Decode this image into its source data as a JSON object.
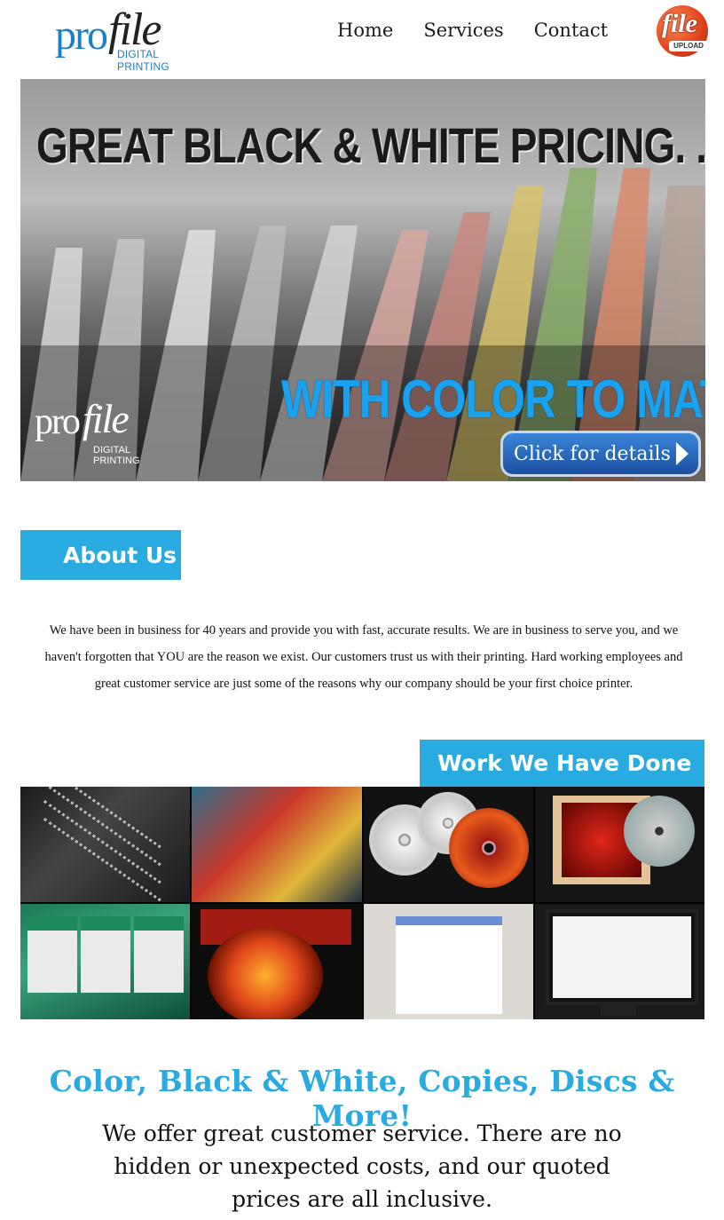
{
  "header": {
    "logo": {
      "pro": "pro",
      "file": "file",
      "sub": "DIGITAL PRINTING"
    },
    "nav": [
      "Home",
      "Services",
      "Contact"
    ],
    "upload_badge": {
      "big": "file",
      "small": "UPLOAD"
    }
  },
  "hero": {
    "headline": "GREAT BLACK & WHITE PRICING. . .",
    "subheadline": "WITH COLOR TO MATCH",
    "logo": {
      "pro": "pro",
      "file": "file",
      "sub": "DIGITAL PRINTING"
    },
    "button_label": "Click for details"
  },
  "about": {
    "tag": "About Us",
    "text": "We have been in business for 40 years and provide you with fast, accurate results. We are in business to serve you, and we haven't forgotten that YOU are the reason we exist. Our customers trust us with their printing. Hard working employees and great customer service are just some of the reasons why our company should be your first choice printer."
  },
  "work": {
    "tag": "Work We Have Done"
  },
  "bottom": {
    "headline": "Color, Black & White, Copies, Discs & More!",
    "body": "We offer great customer service. There are no hidden or unexpected costs, and our quoted prices are all inclusive."
  },
  "colors": {
    "accent": "#29abe2",
    "brand_blue": "#1f7fc4",
    "button": "#2a66c0"
  }
}
